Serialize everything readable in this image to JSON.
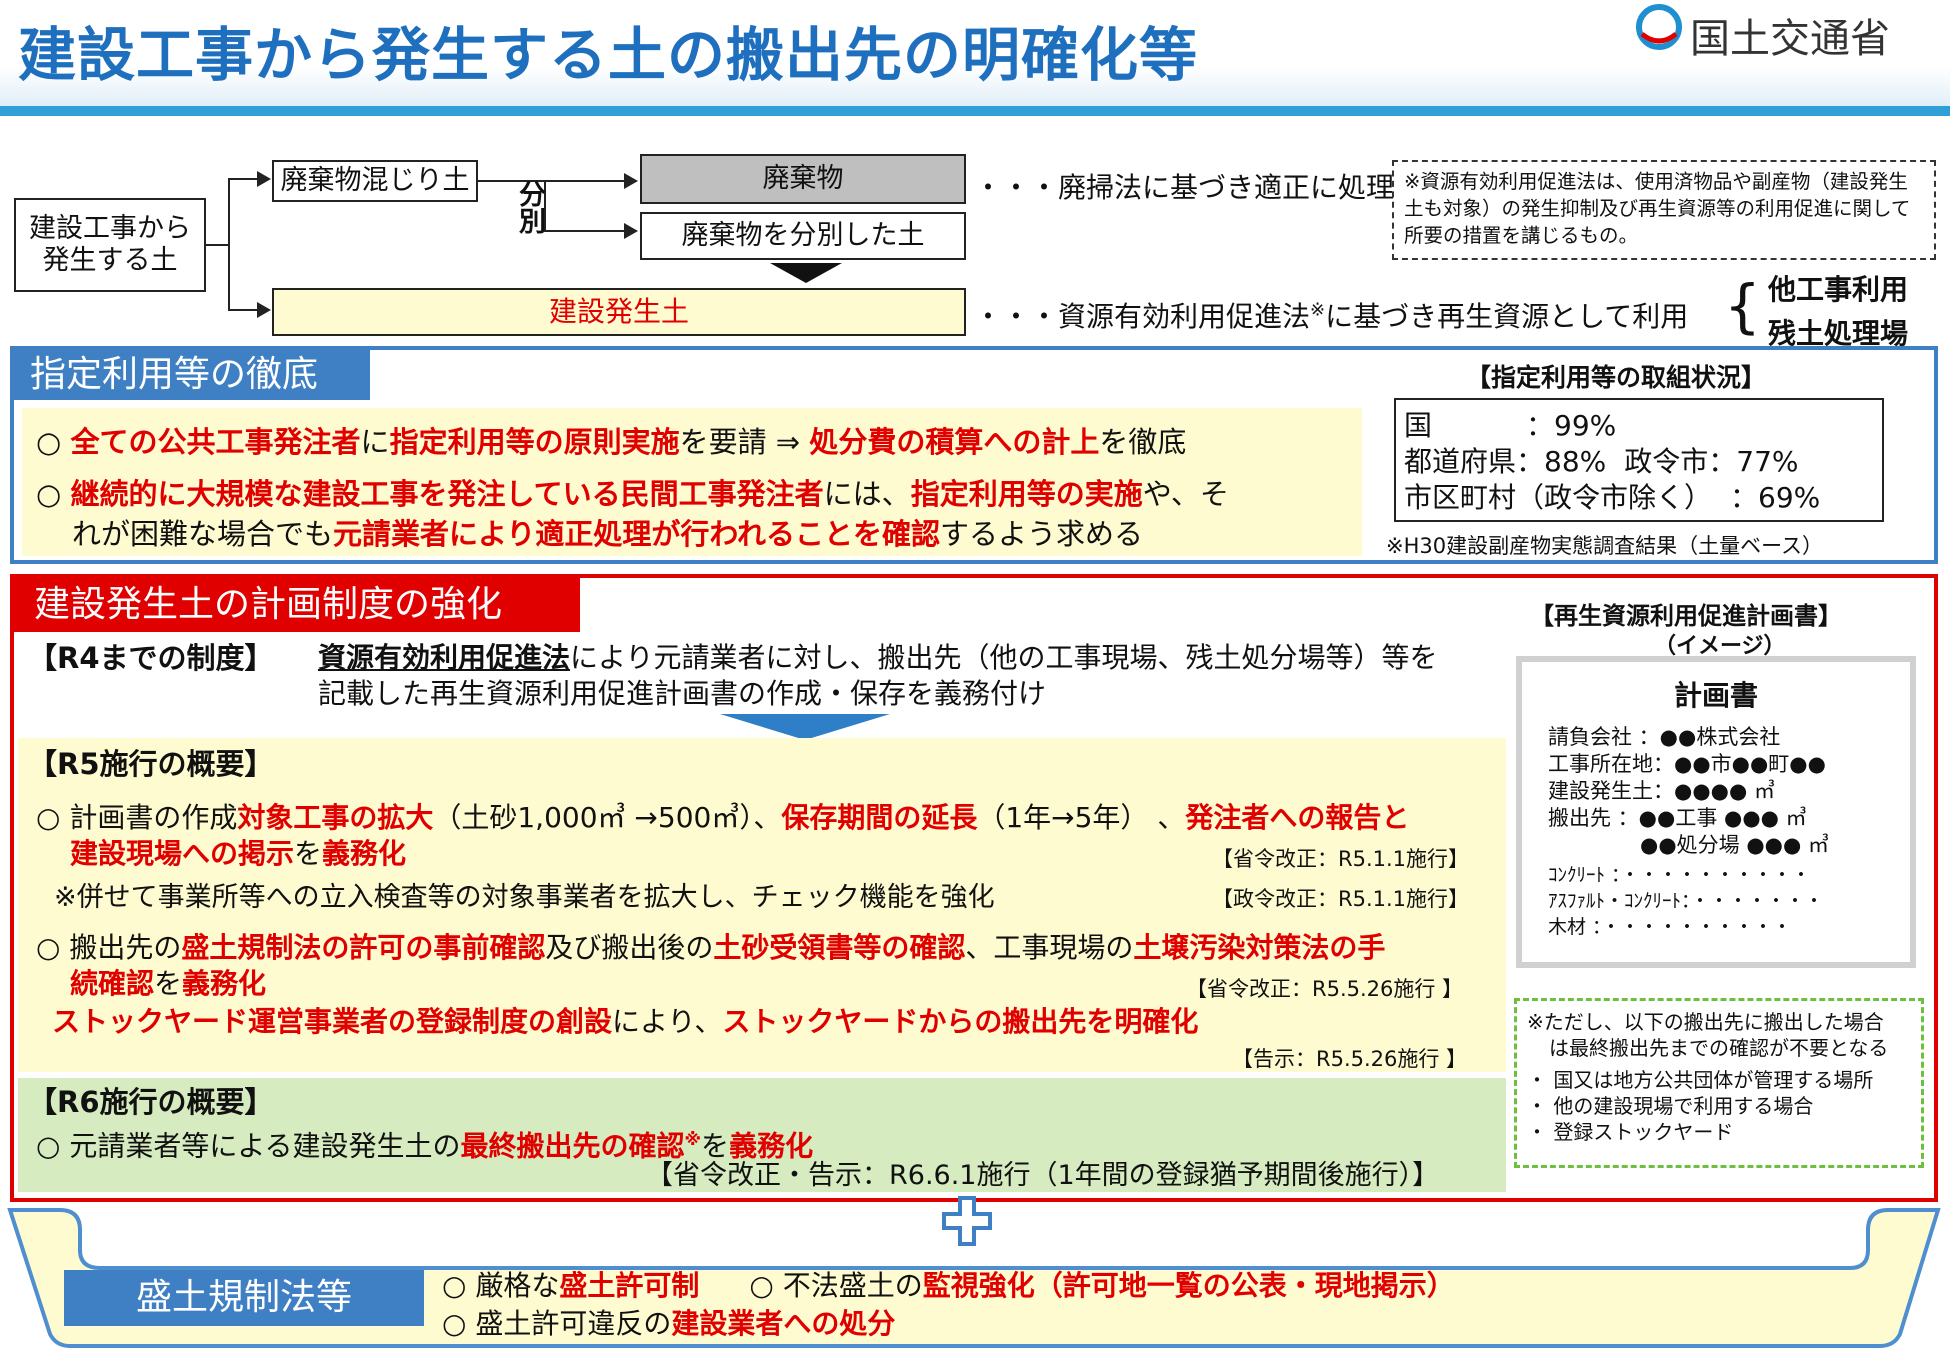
{
  "header": {
    "title": "建設工事から発生する土の搬出先の明確化等",
    "ministry": "国土交通省"
  },
  "flow": {
    "source": "建設工事から発生する土",
    "mixed": "廃棄物混じり土",
    "sort": "分別",
    "waste": "廃棄物",
    "sorted": "廃棄物を分別した土",
    "hassei": "建設発生土",
    "waste_note": "・・・廃掃法に基づき適正に処理",
    "recycle_note_a": "・・・資源有効利用促進法",
    "recycle_note_sup": "※",
    "recycle_note_b": "に基づき再生資源として利用",
    "use1": "他工事利用",
    "use2": "残土処理場",
    "footnote": "※資源有効利用促進法は、使用済物品や副産物（建設発生土も対象）の発生抑制及び再生資源等の利用促進に関して所要の措置を講じるもの。"
  },
  "shitei": {
    "title": "指定利用等の徹底",
    "l1": {
      "a": "○ ",
      "b": "全ての公共工事発注者",
      "c": "に",
      "d": "指定利用等の原則実施",
      "e": "を要請 ⇒ ",
      "f": "処分費の積算への計上",
      "g": "を徹底"
    },
    "l2": {
      "a": "○ ",
      "b": "継続的に大規模な建設工事を発注している民間工事発注者",
      "c": "には、",
      "d": "指定利用等の実施",
      "e": "や、そ"
    },
    "l3": {
      "a": "れが困難な場合でも",
      "b": "元請業者により適正処理が行われることを確認",
      "c": "するよう求める"
    },
    "status_title": "【指定利用等の取組状況】",
    "s1": {
      "label": "国",
      "value": "：99%"
    },
    "s2": {
      "label": "都道府県：88%",
      "label2": "政令市：77%"
    },
    "s3": {
      "label": "市区町村（政令市除く）",
      "value": "：69%"
    },
    "status_note": "※H30建設副産物実態調査結果（土量ベース）"
  },
  "keikaku": {
    "title": "建設発生土の計画制度の強化",
    "r4_label": "【R4までの制度】",
    "r4_a": "資源有効利用促進法",
    "r4_b": "により元請業者に対し、搬出先（他の工事現場、残土処分場等）等を",
    "r4_c": "記載した再生資源利用促進計画書の作成・保存を義務付け",
    "r5_label": "【R5施行の概要】",
    "r5_1": {
      "a": "○ 計画書の作成",
      "b": "対象工事の拡大",
      "c": "（土砂1,000㎥ →500㎥）、",
      "d": "保存期間の延長",
      "e": "（1年→5年） 、",
      "f": "発注者への報告と"
    },
    "r5_2": {
      "a": "建設現場への掲示",
      "b": "を",
      "c": "義務化"
    },
    "r5_ref1": "【省令改正：R5.1.1施行】",
    "r5_3": "※併せて事業所等への立入検査等の対象事業者を拡大し、チェック機能を強化",
    "r5_ref2": "【政令改正：R5.1.1施行】",
    "r5_4": {
      "a": "○ 搬出先の",
      "b": "盛土規制法の許可の事前確認",
      "c": "及び搬出後の",
      "d": "土砂受領書等の確認",
      "e": "、工事現場の",
      "f": "土壌汚染対策法の手"
    },
    "r5_5": {
      "a": "続確認",
      "b": "を",
      "c": "義務化"
    },
    "r5_ref3": "【省令改正：R5.5.26施行 】",
    "r5_6": {
      "a": "ストックヤード運営事業者の登録制度の創設",
      "b": "により、",
      "c": "ストックヤードからの搬出先を明確化"
    },
    "r5_ref4": "【告示：R5.5.26施行 】",
    "r6_label": "【R6施行の概要】",
    "r6_1": {
      "a": "○ 元請業者等による建設発生土の",
      "b": "最終搬出先の確認",
      "sup": "※",
      "c": "を",
      "d": "義務化"
    },
    "r6_ref": "【省令改正・告示：R6.6.1施行（1年間の登録猶予期間後施行）】"
  },
  "plan": {
    "title": "【再生資源利用促進計画書】",
    "sub": "（イメージ）",
    "doc": "計画書",
    "rows": [
      "請負会社 ：●●株式会社",
      "工事所在地：●●市●●町●●",
      "建設発生土：●●●● ㎥",
      "搬出先 ：●●工事 ●●● ㎥",
      "●●処分場 ●●● ㎥",
      "ｺﾝｸﾘｰﾄ ：・・・・・・・・・・",
      "ｱｽﾌｧﾙﾄ・ｺﾝｸﾘｰﾄ：・・・・・・・",
      "木材 ：・・・・・・・・・・"
    ]
  },
  "exception": {
    "l1": "※ただし、以下の搬出先に搬出した場合",
    "l2": "は最終搬出先までの確認が不要となる",
    "items": [
      "・ 国又は地方公共団体が管理する場所",
      "・ 他の建設現場で利用する場合",
      "・ 登録ストックヤード"
    ]
  },
  "morido": {
    "label": "盛土規制法等",
    "l1": {
      "a": "○ 厳格な",
      "b": "盛土許可制",
      "c": "○ 不法盛土の",
      "d": "監視強化",
      "e": "（許可地一覧の公表・現地掲示）"
    },
    "l2": {
      "a": "○ 盛土許可違反の",
      "b": "建設業者への処分"
    }
  },
  "colors": {
    "title_blue": "#1f6fbf",
    "frame_blue": "#3f7fc4",
    "frame_red": "#e00000",
    "cream": "#fffbd0",
    "green": "#d6ebc0"
  }
}
